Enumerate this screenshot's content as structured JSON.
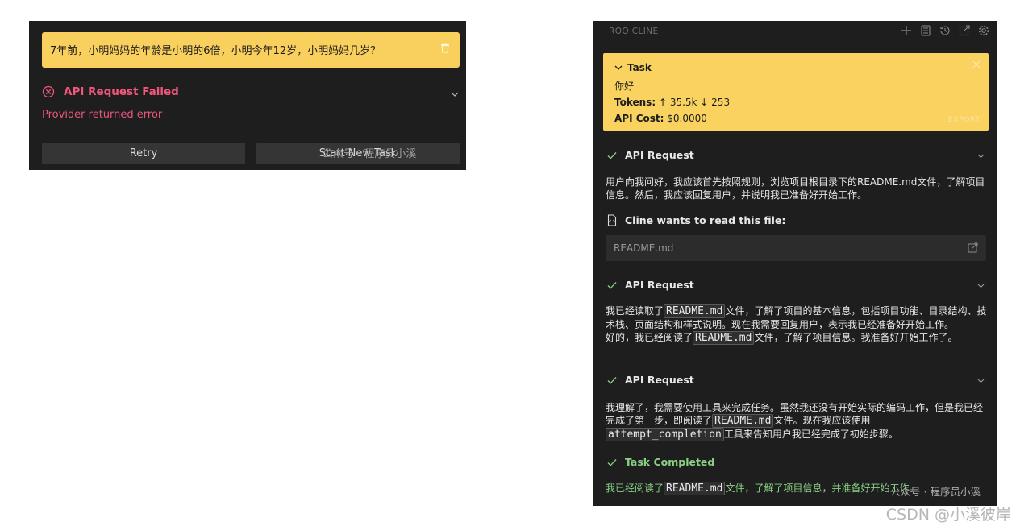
{
  "left": {
    "task_text": "7年前，小明妈妈的年龄是小明的6倍，小明今年12岁，小明妈妈几岁？",
    "error_title": "API Request Failed",
    "error_message": "Provider returned error",
    "retry_label": "Retry",
    "new_task_label": "Start New Task",
    "watermark": "公众号 · 程序员小溪"
  },
  "right": {
    "header_title": "ROO CLINE",
    "header_icons": [
      "plus-icon",
      "history-list-icon",
      "history-icon",
      "popout-icon",
      "gear-icon"
    ],
    "task": {
      "label": "Task",
      "text": "你好",
      "tokens_label": "Tokens:",
      "tokens_value": "↑ 35.5k ↓ 253",
      "cost_label": "API Cost:",
      "cost_value": "$0.0000",
      "export_label": "EXPORT"
    },
    "sections": [
      {
        "title": "API Request",
        "text": "用户向我问好，我应该首先按照规则，浏览项目根目录下的README.md文件，了解项目信息。然后，我应该回复用户，并说明我已准备好开始工作。"
      },
      {
        "title": "API Request",
        "p1_a": "我已经读取了",
        "p1_code": "README.md",
        "p1_b": "文件，了解了项目的基本信息，包括项目功能、目录结构、技术栈、页面结构和样式说明。现在我需要回复用户，表示我已经准备好开始工作。",
        "p2_a": "好的，我已经阅读了",
        "p2_code": "README.md",
        "p2_b": "文件，了解了项目信息。我准备好开始工作了。"
      },
      {
        "title": "API Request",
        "p_a": "我理解了，我需要使用工具来完成任务。虽然我还没有开始实际的编码工作，但是我已经完成了第一步，即阅读了",
        "p_code": "README.md",
        "p_b": "文件。现在我应该使用",
        "p_code2": "attempt_completion",
        "p_c": "工具来告知用户我已经完成了初始步骤。"
      },
      {
        "title": "Task Completed",
        "p_a": "我已经阅读了",
        "p_code": "README.md",
        "p_b": "文件，了解了项目信息，并准备好开始工作。"
      }
    ],
    "read_file": {
      "label": "Cline wants to read this file:",
      "file": "README.md"
    },
    "watermark": "公众号 · 程序员小溪"
  },
  "csdn_watermark": "CSDN @小溪彼岸",
  "colors": {
    "panel_bg": "#1e1e1e",
    "task_yellow": "#f9d25f",
    "error_pink": "#f1567c",
    "success_green": "#89d185"
  }
}
